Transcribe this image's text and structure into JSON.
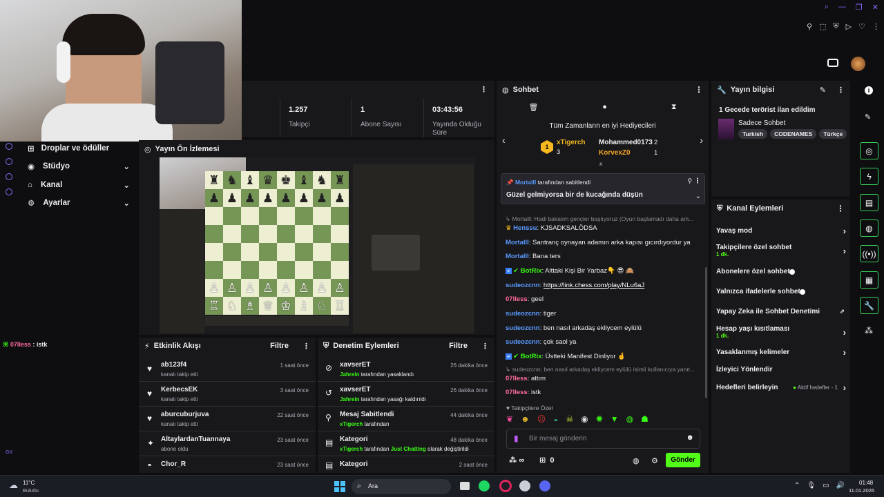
{
  "top_icons": [
    "search-icon",
    "minimize-icon",
    "restore-icon",
    "close-icon"
  ],
  "left_nav": {
    "items": [
      {
        "label": "Droplar ve ödüller",
        "icon": "gift-icon"
      },
      {
        "label": "Stüdyo",
        "icon": "studio-icon"
      },
      {
        "label": "Kanal",
        "icon": "channel-icon"
      },
      {
        "label": "Ayarlar",
        "icon": "gear-icon"
      }
    ],
    "chat_overlay_user": "07lless",
    "chat_overlay_msg": " : istk",
    "gx_label": "GX"
  },
  "stats": {
    "followers_value": "1.257",
    "followers_label": "Takipçi",
    "subs_value": "1",
    "subs_label": "Abone Sayısı",
    "uptime_value": "03:43:56",
    "uptime_label": "Yayında Olduğu Süre"
  },
  "preview": {
    "title": "Yayın Ön İzlemesi"
  },
  "activity": {
    "title": "Etkinlik Akışı",
    "filter": "Filtre",
    "items": [
      {
        "name": "ab123f4",
        "sub": "kanalı takip etti",
        "time": "1 saat önce"
      },
      {
        "name": "KerbecsEK",
        "sub": "kanalı takip etti",
        "time": "3 saat önce"
      },
      {
        "name": "aburcuburjuva",
        "sub": "kanalı takip etti",
        "time": "22 saat önce"
      },
      {
        "name": "AltaylardanTuannaya",
        "sub": "abone oldu",
        "time": "23 saat önce"
      },
      {
        "name": "Chor_R",
        "sub": "",
        "time": "23 saat önce"
      }
    ]
  },
  "moderation": {
    "title": "Denetim Eylemleri",
    "filter": "Filtre",
    "items": [
      {
        "name": "xavserET",
        "actor": "Jahrein",
        "rest": " tarafından yasaklandı",
        "time": "26 dakika önce"
      },
      {
        "name": "xavserET",
        "actor": "Jahrein",
        "rest": " tarafından yasağı kaldırıldı",
        "time": "26 dakika önce"
      },
      {
        "name": "Mesaj Sabitlendi",
        "actor": "xTigerch",
        "rest": " tarafından",
        "time": "44 dakika önce"
      },
      {
        "name": "Kategori",
        "actor": "xTigerch",
        "rest": " tarafından ",
        "extra": "Just Chatting",
        "rest2": " olarak değiştirildi",
        "time": "48 dakika önce"
      },
      {
        "name": "Kategori",
        "actor": "",
        "rest": "",
        "time": "2 saat önce"
      }
    ]
  },
  "chat": {
    "title": "Sohbet",
    "gifters_title": "Tüm Zamanların en iyi Hediyecileri",
    "gifters": [
      {
        "name": "xTigerch",
        "count": "3"
      },
      {
        "name": "Mohammed0173",
        "count": "2"
      },
      {
        "name": "KorvexZ0",
        "count": "1"
      }
    ],
    "pinned_by": "Mortalll",
    "pinned_by_suffix": " tarafından sabitlendi",
    "pinned_msg": "Güzel gelmiyorsa bir de kucağında düşün",
    "messages": [
      {
        "reply": "Mortalll: Hadi bakalım gençler başlıyoruz (Oyun başlamadı daha am...",
        "user": "",
        "text": ""
      },
      {
        "user": "Henssu",
        "color": "#5b9bff",
        "text": ": KJSADKSALÖDSA",
        "badge": "crown"
      },
      {
        "user": "Mortalll",
        "color": "#5b9bff",
        "text": ": Santranç oynayan adamın arka kapısı gıcırdıyordur ya"
      },
      {
        "user": "Mortalll",
        "color": "#5b9bff",
        "text": ": Bana ters"
      },
      {
        "user": "BotRix",
        "color": "#39ff14",
        "text": ": Alttaki Kişi Bir Yarbaz👇 😎 🙈",
        "badge": "bot"
      },
      {
        "user": "sudeozcnn",
        "color": "#5b9bff",
        "text": ": ",
        "link": "https://link.chess.com/play/NLu6aJ"
      },
      {
        "user": "07lless",
        "color": "#ff6b9a",
        "text": ": geel"
      },
      {
        "user": "sudeozcnn",
        "color": "#5b9bff",
        "text": ": tiger"
      },
      {
        "user": "sudeozcnn",
        "color": "#5b9bff",
        "text": ": ben nasıl arkadaş ekliycem eylülü"
      },
      {
        "user": "sudeozcnn",
        "color": "#5b9bff",
        "text": ": çok saol ya"
      },
      {
        "user": "BotRix",
        "color": "#39ff14",
        "text": ": Üstteki Manifest Dinliyor 🤞",
        "badge": "bot"
      },
      {
        "reply": "sudeozcnn: ben nasıl arkadaş ekliycem eylülü isimli kullanıcıya yanıt...",
        "user": "07lless",
        "color": "#ff6b9a",
        "text": ": attım"
      },
      {
        "user": "07lless",
        "color": "#ff6b9a",
        "text": ": istk"
      }
    ],
    "followers_only": "Takipçilere Özel",
    "input_placeholder": "Bir mesaj gönderin",
    "points": "∞",
    "gift_count": "0",
    "send": "Gönder"
  },
  "stream_info": {
    "title": "Yayın bilgisi",
    "stream_title": "1 Gecede terörist ilan edildim",
    "category": "Sadece Sohbet",
    "tags": [
      "Turkish",
      "CODENAMES",
      "Türkçe"
    ]
  },
  "channel_actions": {
    "title": "Kanal Eylemleri",
    "items": [
      {
        "label": "Yavaş mod",
        "type": "arrow"
      },
      {
        "label": "Takipçilere özel sohbet",
        "sub": "1 dk.",
        "type": "arrow"
      },
      {
        "label": "Abonelere özel sohbet",
        "type": "toggle"
      },
      {
        "label": "Yalnızca ifadelerle sohbet",
        "type": "toggle"
      },
      {
        "label": "Yapay Zeka ile Sohbet Denetimi",
        "type": "ext"
      },
      {
        "label": "Hesap yaşı kısıtlaması",
        "sub": "1 dk.",
        "type": "arrow"
      },
      {
        "label": "Yasaklanmış kelimeler",
        "type": "arrow"
      },
      {
        "label": "İzleyici Yönlendir",
        "type": "none"
      },
      {
        "label": "Hedefleri belirleyin",
        "right": "Aktif hedefler - 1",
        "type": "arrow"
      }
    ]
  },
  "taskbar": {
    "weather_temp": "11°C",
    "weather_desc": "Bulutlu",
    "search": "Ara",
    "time": "01:48",
    "date": "11.01.2026"
  },
  "colors": {
    "accent": "#53fc18",
    "bg": "#0e0e10",
    "panel": "#18181b"
  }
}
